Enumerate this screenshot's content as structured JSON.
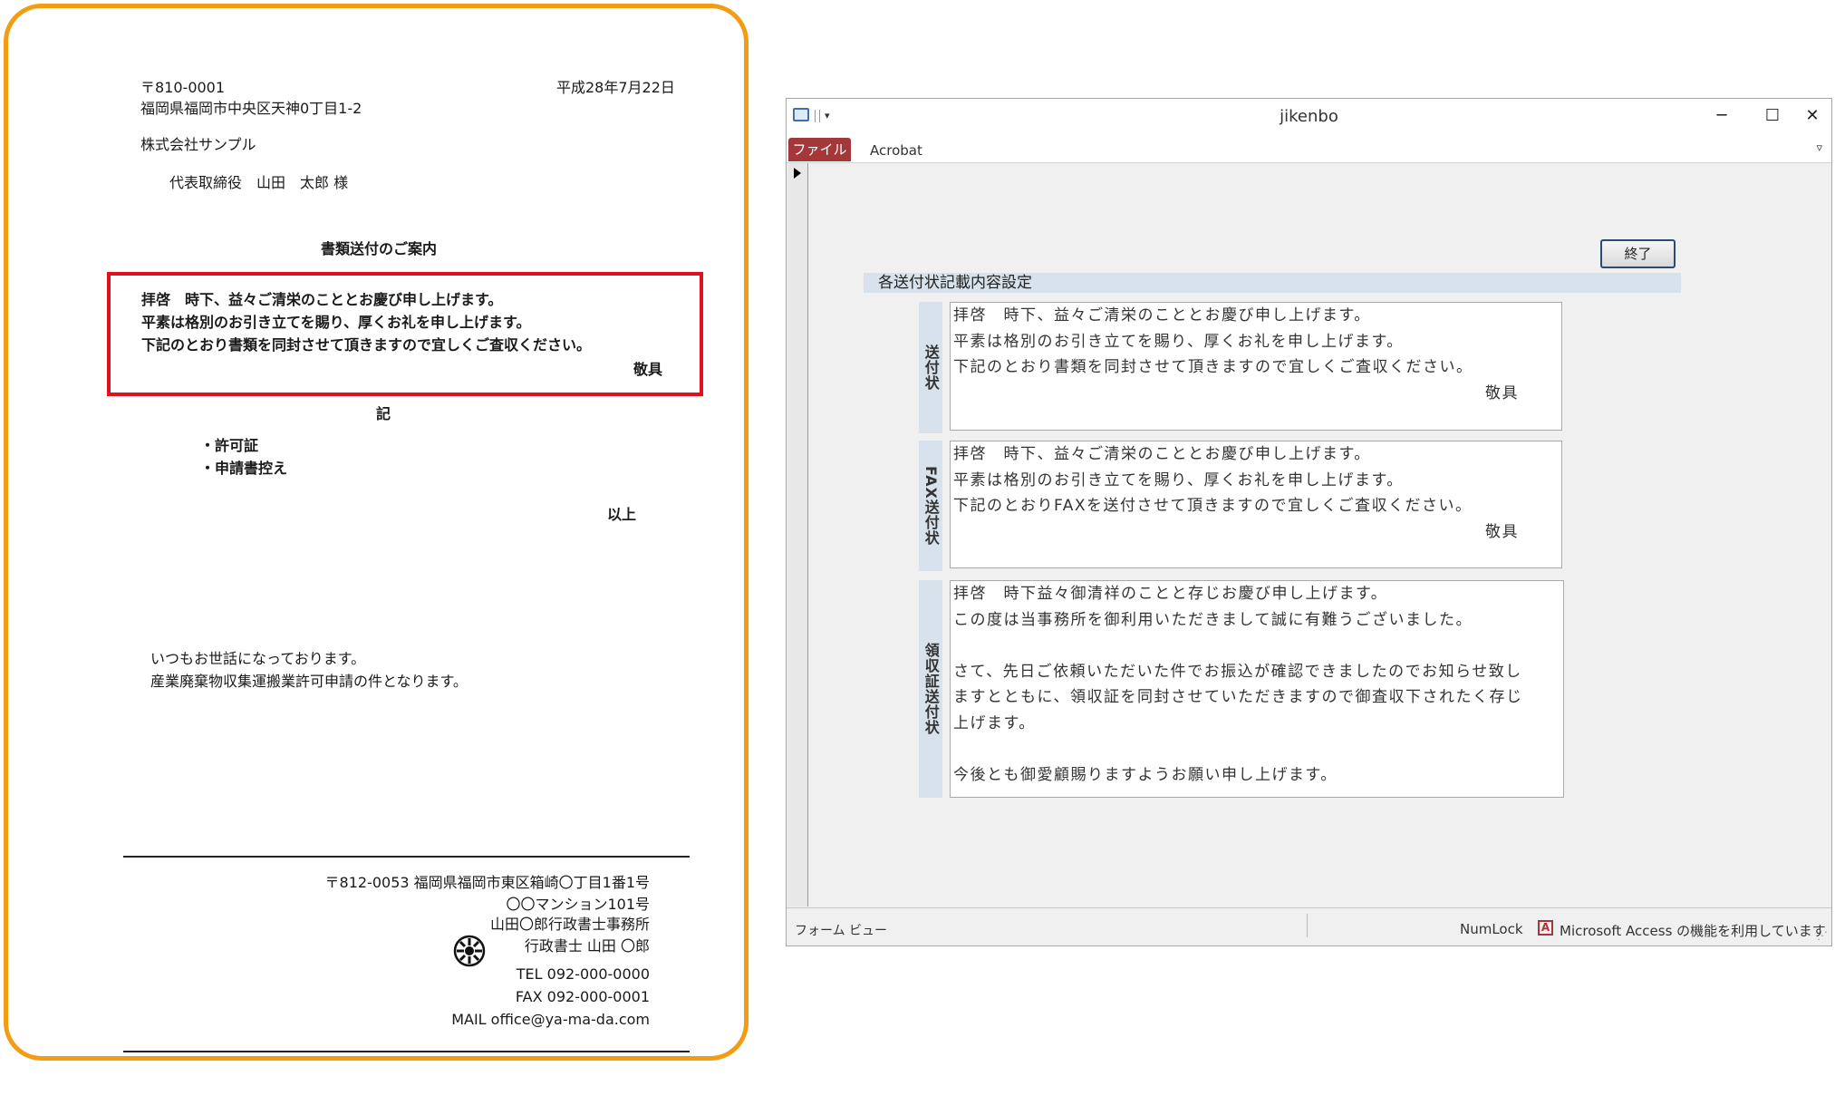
{
  "letter": {
    "postal": "〒810-0001",
    "date": "平成28年7月22日",
    "address": "福岡県福岡市中央区天神0丁目1-2",
    "company": "株式会社サンプル",
    "recipient": "代表取締役　山田　太郎 様",
    "subject": "書類送付のご案内",
    "body_line1": "拝啓　時下、益々ご清栄のこととお慶び申し上げます。",
    "body_line2": "平素は格別のお引き立てを賜り、厚くお礼を申し上げます。",
    "body_line3": "下記のとおり書類を同封させて頂きますので宜しくご査収ください。",
    "closing": "敬具",
    "ki": "記",
    "item1": "・許可証",
    "item2": "・申請書控え",
    "ijo": "以上",
    "note_line1": "いつもお世話になっております。",
    "note_line2": "産業廃棄物収集運搬業許可申請の件となります。",
    "footer_addr1": "〒812-0053 福岡県福岡市東区箱崎〇丁目1番1号",
    "footer_addr2": "〇〇マンション101号",
    "footer_office": "山田〇郎行政書士事務所",
    "footer_person": "行政書士 山田 〇郎",
    "footer_tel": "TEL 092-000-0000",
    "footer_fax": "FAX 092-000-0001",
    "footer_mail": "MAIL office@ya-ma-da.com"
  },
  "window": {
    "title": "jikenbo",
    "tab_file": "ファイル",
    "tab_acrobat": "Acrobat",
    "minimize": "─",
    "maximize": "☐",
    "close": "✕"
  },
  "form": {
    "close_button": "終了",
    "section_title": "各送付状記載内容設定",
    "label_cover": "送付状",
    "label_fax": "FAX送付状",
    "label_receipt": "領収証送付状",
    "cover_text": "拝啓　時下、益々ご清栄のこととお慶び申し上げます。\n平素は格別のお引き立てを賜り、厚くお礼を申し上げます。\n下記のとおり書類を同封させて頂きますので宜しくご査収ください。",
    "cover_closing": "敬具",
    "fax_text": "拝啓　時下、益々ご清栄のこととお慶び申し上げます。\n平素は格別のお引き立てを賜り、厚くお礼を申し上げます。\n下記のとおりFAXを送付させて頂きますので宜しくご査収ください。",
    "fax_closing": "敬具",
    "receipt_text": "拝啓　時下益々御清祥のことと存じお慶び申し上げます。\nこの度は当事務所を御利用いただきまして誠に有難うございました。\n\nさて、先日ご依頼いただいた件でお振込が確認できましたのでお知らせ致し\nますとともに、領収証を同封させていただきますので御査収下されたく存じ\n上げます。\n\n今後とも御愛顧賜りますようお願い申し上げます。"
  },
  "status": {
    "view": "フォーム ビュー",
    "numlock": "NumLock",
    "message": "Microsoft Access の機能を利用しています"
  }
}
